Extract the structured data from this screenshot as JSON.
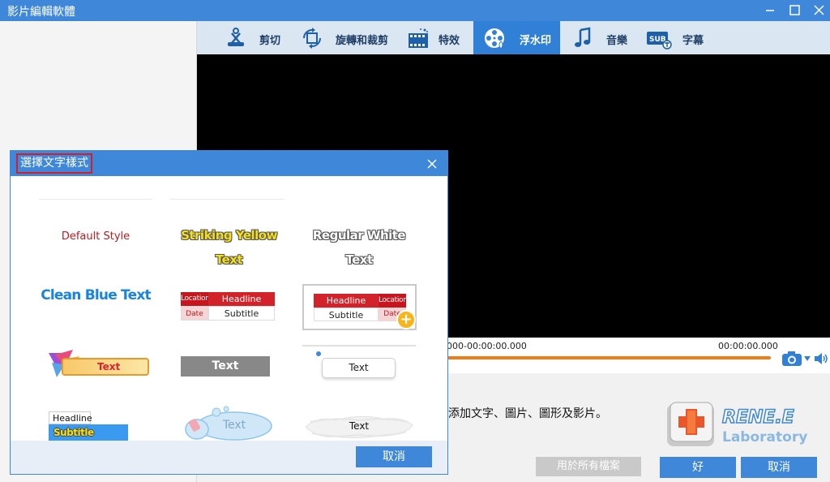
{
  "window": {
    "title": "影片編輯軟體",
    "controls": [
      "minimize-icon",
      "maximize-icon",
      "close-icon"
    ]
  },
  "tabs": [
    {
      "label": "剪切",
      "icon": "scissors-icon",
      "active": false
    },
    {
      "label": "旋轉和裁剪",
      "icon": "rotate-crop-icon",
      "active": false
    },
    {
      "label": "特效",
      "icon": "film-effects-icon",
      "active": false
    },
    {
      "label": "浮水印",
      "icon": "film-reel-watermark-icon",
      "active": true
    },
    {
      "label": "音樂",
      "icon": "music-note-icon",
      "active": false
    },
    {
      "label": "字幕",
      "icon": "subtitle-icon",
      "active": false
    }
  ],
  "player": {
    "time_range": "000-00:00:00.000",
    "time_end": "00:00:00.000",
    "progress": 1.0,
    "icons": [
      "camera-icon",
      "dropdown-arrow-icon",
      "volume-icon"
    ]
  },
  "bottom": {
    "hint": "添加文字、圖片、圖形及影片。",
    "logo": {
      "line1": "RENE.E",
      "line2": "Laboratory"
    },
    "apply_all_label": "用於所有檔案",
    "ok_label": "好",
    "cancel_label": "取消"
  },
  "dialog": {
    "title": "選擇文字樣式",
    "cancel_label": "取消",
    "styles": [
      {
        "id": "default",
        "text": "Default Style"
      },
      {
        "id": "striking-yellow",
        "text": "Striking Yellow Text"
      },
      {
        "id": "regular-white",
        "text": "Regular White Text"
      },
      {
        "id": "clean-blue",
        "text": "Clean Blue Text"
      },
      {
        "id": "headline-red",
        "location": "Location",
        "headline": "Headline",
        "date": "Date",
        "subtitle": "Subtitle"
      },
      {
        "id": "headline-red-selected",
        "location": "Location",
        "headline": "Headline",
        "date": "Date",
        "subtitle": "Subtitle",
        "selected": true
      },
      {
        "id": "gradient-banner",
        "text": "Text"
      },
      {
        "id": "gray-box",
        "text": "Text"
      },
      {
        "id": "rounded-box",
        "text": "Text"
      },
      {
        "id": "headline-subtitle-blue",
        "headline": "Headline",
        "subtitle": "Subtitle"
      },
      {
        "id": "cloud-bubble",
        "text": "Text"
      },
      {
        "id": "brush-stroke",
        "text": "Text"
      }
    ]
  },
  "colors": {
    "accent": "#3e87d9",
    "tabbar": "#dbe6f3",
    "progress": "#f07d1a",
    "highlight_border": "#d0202c"
  }
}
